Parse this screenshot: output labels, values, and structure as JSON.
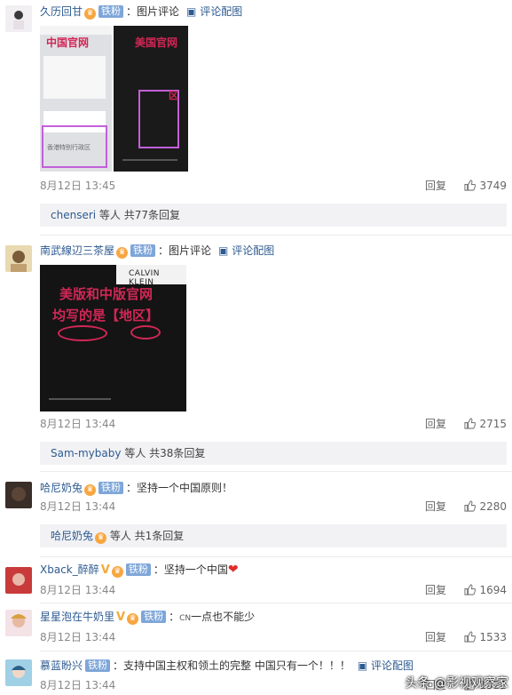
{
  "comments": [
    {
      "user": "久历回甘",
      "badge": "铁粉",
      "text": "图片评论",
      "link": "评论配图",
      "time": "8月12日 13:45",
      "reply": "回复",
      "likes": "3749",
      "subreply_user": "chenseri",
      "subreply_text": "等人 共77条回复",
      "image_left_label": "中国官网",
      "image_left_caption": "香港特别行政区",
      "image_right_label": "美国官网",
      "image_right_caption": "区"
    },
    {
      "user": "南武線辺三茶屋",
      "badge": "铁粉",
      "text": "图片评论",
      "link": "评论配图",
      "time": "8月12日 13:44",
      "reply": "回复",
      "likes": "2715",
      "subreply_user": "Sam-mybaby",
      "subreply_text": "等人 共38条回复",
      "image_brand": "CALVIN KLEIN",
      "image_line1": "美版和中版官网",
      "image_line2": "均写的是【地区】"
    },
    {
      "user": "哈尼奶兔",
      "badge": "铁粉",
      "text": "：坚持一个中国原则！",
      "time": "8月12日 13:44",
      "reply": "回复",
      "likes": "2280",
      "subreply_user": "哈尼奶兔",
      "subreply_text": "等人 共1条回复"
    },
    {
      "user": "Xback_醉醉",
      "badge": "铁粉",
      "text": "：坚持一个中国",
      "time": "8月12日 13:44",
      "reply": "回复",
      "likes": "1694"
    },
    {
      "user": "星星泡在牛奶里",
      "badge": "铁粉",
      "text": "：",
      "cn": "CN",
      "text2": "一点也不能少",
      "time": "8月12日 13:44",
      "reply": "回复",
      "likes": "1533"
    },
    {
      "user": "慕蓝盼兴",
      "badge": "铁粉",
      "text": "：支持中国主权和领土的完整 中国只有一个！！！",
      "link": "评论配图",
      "time": "8月12日 13:44",
      "reply": "回复",
      "likes": "1322"
    }
  ],
  "watermark": "头条 @影视观察家",
  "colors": {
    "link": "#2d5a90",
    "badge": "#7ea6d8",
    "highlight": "#d12756"
  }
}
